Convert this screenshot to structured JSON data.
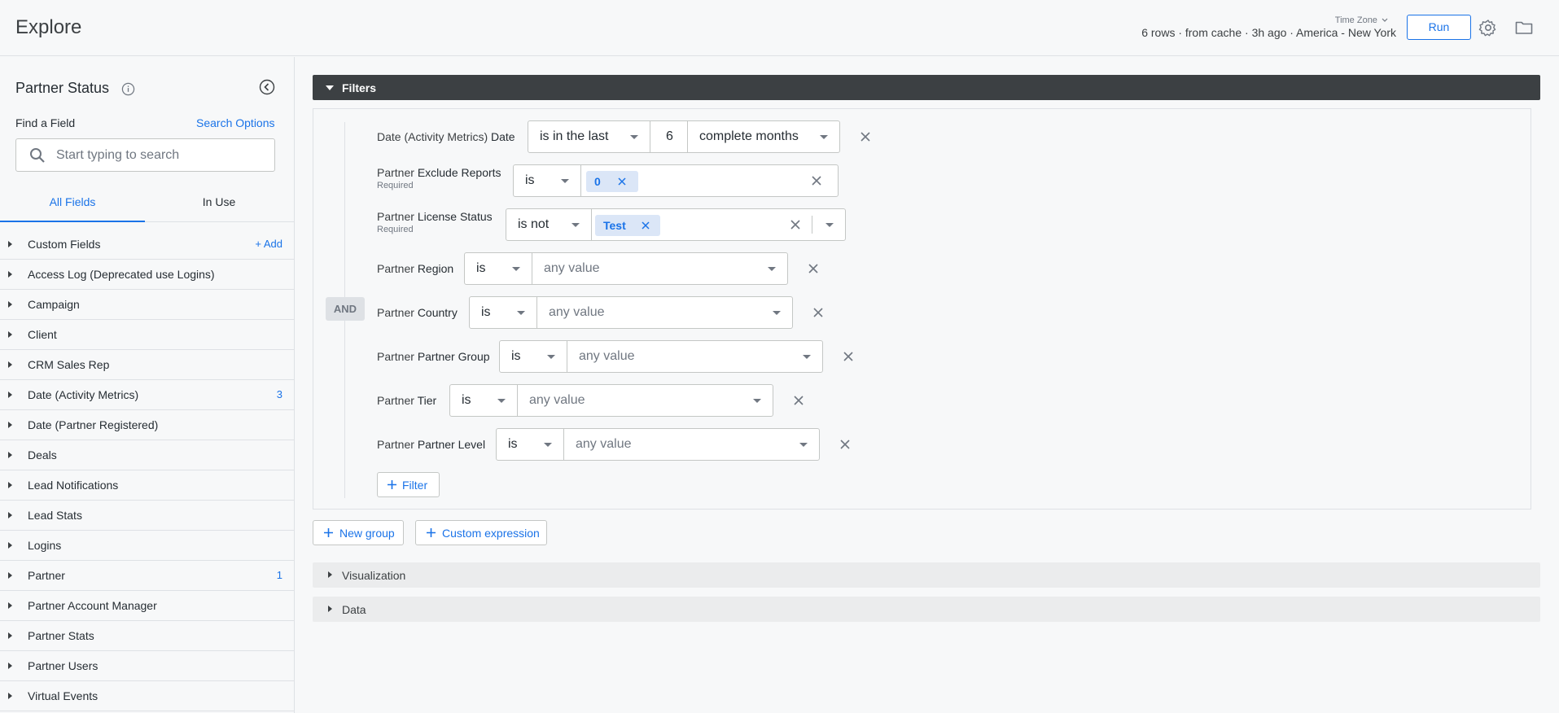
{
  "header": {
    "title": "Explore",
    "timezone_label": "Time Zone",
    "status": "6 rows · from cache · 3h ago · America - New York",
    "run_label": "Run",
    "icons": [
      "gear-icon",
      "folder-icon"
    ]
  },
  "sidebar": {
    "title": "Partner Status",
    "find_label": "Find a Field",
    "search_options": "Search Options",
    "search_placeholder": "Start typing to search",
    "tabs": [
      "All Fields",
      "In Use"
    ],
    "items": [
      {
        "label": "Custom Fields",
        "action": "Add"
      },
      {
        "label": "Access Log (Deprecated use Logins)"
      },
      {
        "label": "Campaign"
      },
      {
        "label": "Client"
      },
      {
        "label": "CRM Sales Rep"
      },
      {
        "label": "Date (Activity Metrics)",
        "count": "3"
      },
      {
        "label": "Date (Partner Registered)"
      },
      {
        "label": "Deals"
      },
      {
        "label": "Lead Notifications"
      },
      {
        "label": "Lead Stats"
      },
      {
        "label": "Logins"
      },
      {
        "label": "Partner",
        "count": "1"
      },
      {
        "label": "Partner Account Manager"
      },
      {
        "label": "Partner Stats"
      },
      {
        "label": "Partner Users"
      },
      {
        "label": "Virtual Events"
      }
    ]
  },
  "filters": {
    "section_label": "Filters",
    "and_label": "AND",
    "rows": [
      {
        "view": "Date (Activity Metrics)",
        "field": "Date",
        "operator": "is in the last",
        "number": "6",
        "unit": "complete months"
      },
      {
        "view": "Partner",
        "field": "Exclude Reports",
        "required": "Required",
        "operator": "is",
        "chip": "0"
      },
      {
        "view": "Partner",
        "field": "License Status",
        "required": "Required",
        "operator": "is not",
        "chip": "Test"
      },
      {
        "view": "Partner",
        "field": "Region",
        "operator": "is",
        "value_placeholder": "any value"
      },
      {
        "view": "Partner",
        "field": "Country",
        "operator": "is",
        "value_placeholder": "any value"
      },
      {
        "view": "Partner",
        "field": "Partner Group",
        "operator": "is",
        "value_placeholder": "any value"
      },
      {
        "view": "Partner",
        "field": "Tier",
        "operator": "is",
        "value_placeholder": "any value"
      },
      {
        "view": "Partner",
        "field": "Partner Level",
        "operator": "is",
        "value_placeholder": "any value"
      }
    ],
    "add_filter_label": "Filter",
    "new_group_label": "New group",
    "custom_expression_label": "Custom expression"
  },
  "sections": {
    "visualization": "Visualization",
    "data": "Data"
  },
  "colors": {
    "accent": "#1a73e8",
    "filters_bar": "#3c4043",
    "chip_bg": "#dbe6f7"
  }
}
